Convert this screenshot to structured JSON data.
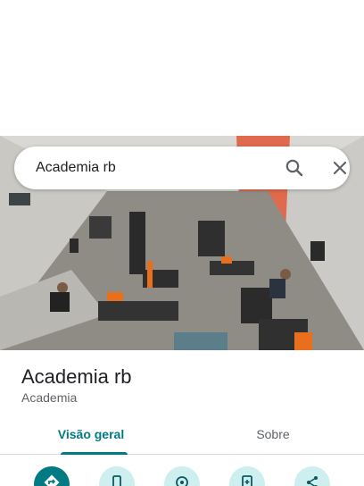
{
  "search": {
    "query": "Academia rb"
  },
  "place": {
    "name": "Academia rb",
    "category": "Academia"
  },
  "tabs": [
    {
      "label": "Visão geral",
      "active": true
    },
    {
      "label": "Sobre",
      "active": false
    }
  ],
  "actions": [
    {
      "icon": "directions-icon"
    },
    {
      "icon": "phone-icon"
    },
    {
      "icon": "nearby-icon"
    },
    {
      "icon": "save-to-phone-icon"
    },
    {
      "icon": "share-icon"
    }
  ],
  "colors": {
    "accent": "#007b83",
    "accent_light": "#cdeff0",
    "title": "#202124",
    "subtitle": "#5f6368"
  }
}
